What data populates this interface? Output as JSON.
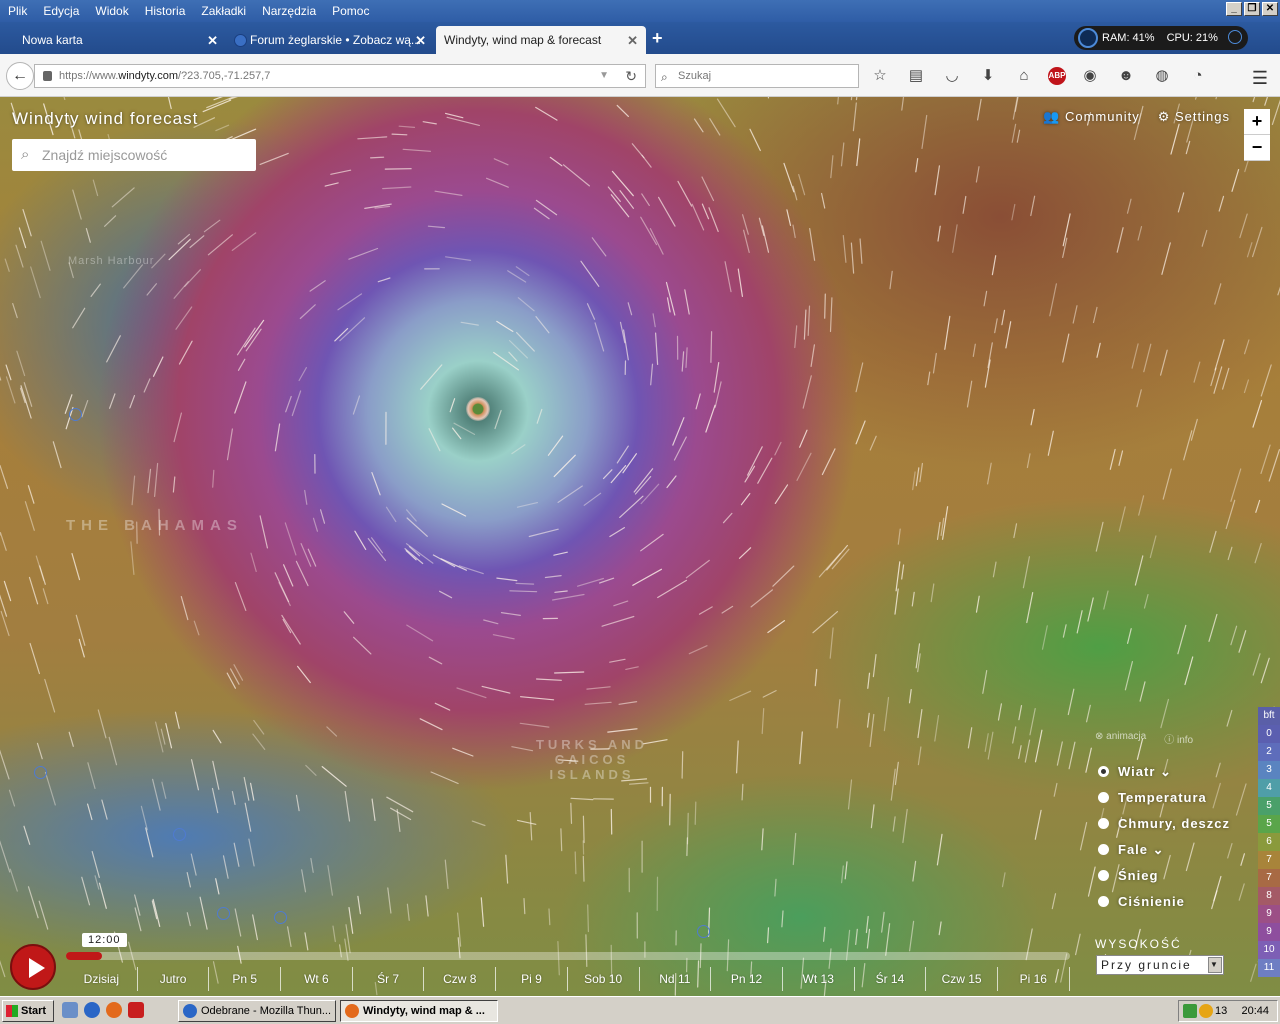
{
  "menu": {
    "items": [
      "Plik",
      "Edycja",
      "Widok",
      "Historia",
      "Zakładki",
      "Narzędzia",
      "Pomoc"
    ]
  },
  "tabs": [
    {
      "label": "Nowa karta",
      "icon": "none"
    },
    {
      "label": "Forum żeglarskie • Zobacz wą...",
      "icon": "forum-favicon"
    },
    {
      "label": "Windyty, wind map & forecast",
      "icon": "none",
      "active": true
    }
  ],
  "sysmon": {
    "ram": "RAM: 41%",
    "cpu": "CPU: 21%"
  },
  "nav": {
    "url_prefix": "https://www.",
    "url_host": "windyty.com",
    "url_path": "/?23.705,-71.257,7",
    "search_placeholder": "Szukaj"
  },
  "map": {
    "brand": "Windyty wind forecast",
    "search_placeholder": "Znajdź miejscowość",
    "community": "Community",
    "settings": "Settings",
    "zoom_in": "+",
    "zoom_out": "−",
    "labels": {
      "bahamas": "THE BAHAMAS",
      "turks": "TURKS AND CAICOS ISLANDS",
      "marsh_harbour": "Marsh Harbour"
    },
    "panel": {
      "animation": "animacja",
      "info": "info",
      "layers": [
        {
          "label": "Wiatr",
          "selected": true,
          "has_menu": true
        },
        {
          "label": "Temperatura",
          "selected": false
        },
        {
          "label": "Chmury, deszcz",
          "selected": false
        },
        {
          "label": "Fale",
          "selected": false,
          "has_menu": true
        },
        {
          "label": "Śnieg",
          "selected": false
        },
        {
          "label": "Ciśnienie",
          "selected": false
        }
      ],
      "altitude_label": "WYSOKOŚĆ",
      "altitude_value": "Przy gruncie"
    },
    "scale": {
      "unit": "bft",
      "values": [
        "0",
        "2",
        "3",
        "4",
        "5",
        "5",
        "6",
        "7",
        "7",
        "8",
        "9",
        "9",
        "10",
        "11"
      ],
      "colors": [
        "#5b5fb0",
        "#5e6dbb",
        "#5a84c0",
        "#4f9ea8",
        "#4aa06a",
        "#5aa54a",
        "#8a9a3c",
        "#a8843a",
        "#a86a44",
        "#a45a66",
        "#9c4f86",
        "#8e4e9e",
        "#7d5fb5",
        "#6e7ec3"
      ]
    },
    "timeline": {
      "time": "12:00",
      "progress": 0.036,
      "days": [
        "Dzisiaj",
        "Jutro",
        "Pn 5",
        "Wt 6",
        "Śr 7",
        "Czw 8",
        "Pi 9",
        "Sob 10",
        "Nd 11",
        "Pn 12",
        "Wt 13",
        "Śr 14",
        "Czw 15",
        "Pi 16"
      ]
    }
  },
  "taskbar": {
    "start": "Start",
    "tasks": [
      {
        "label": "Odebrane - Mozilla Thun...",
        "active": false
      },
      {
        "label": "Windyty, wind map & ...",
        "active": true
      }
    ],
    "tray_temp": "13",
    "clock": "20:44"
  }
}
